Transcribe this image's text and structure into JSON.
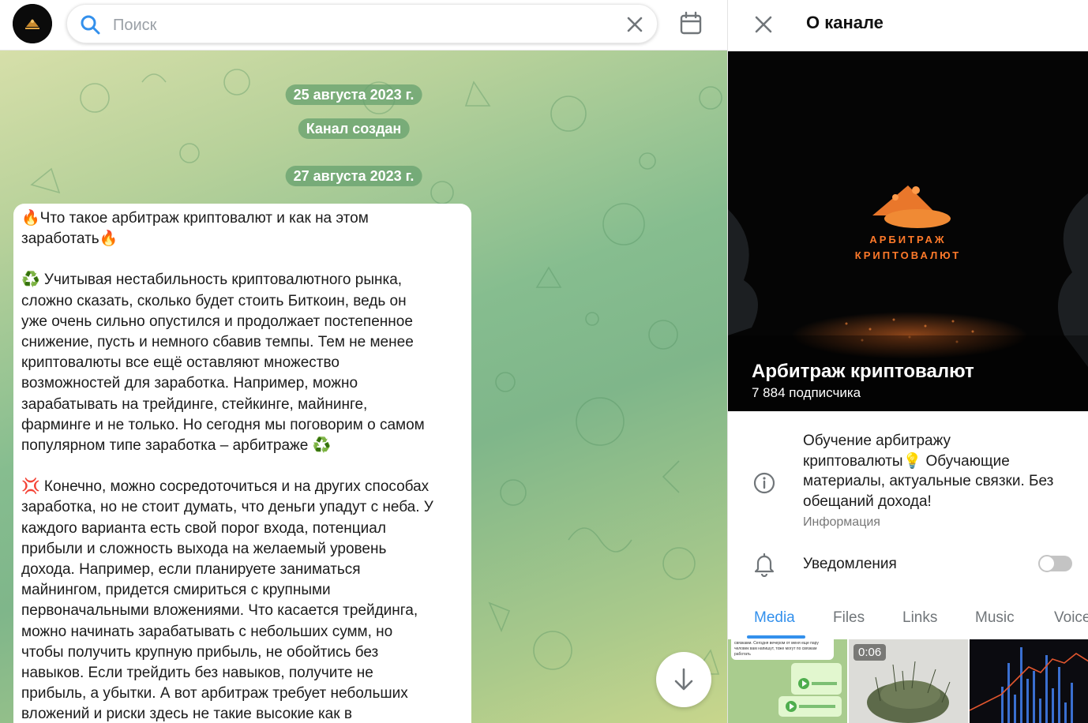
{
  "search": {
    "placeholder": "Поиск"
  },
  "chat": {
    "dates": [
      "25 августа 2023 г.",
      "27 августа 2023 г."
    ],
    "service_message": "Канал создан",
    "message": {
      "lines1": [
        "🔥Что такое арбитраж криптовалют и как на этом",
        "заработать🔥"
      ],
      "lines2": [
        "♻️ Учитывая нестабильность криптовалютного рынка,",
        "сложно сказать, сколько будет стоить Биткоин, ведь он",
        "уже очень сильно опустился и продолжает постепенное",
        "снижение, пусть и немного сбавив темпы. Тем не менее",
        "криптовалюты все ещё оставляют множество",
        "возможностей для заработка. Например, можно",
        "зарабатывать на трейдинге, стейкинге, майнинге,",
        "фарминге и не только. Но сегодня мы поговорим о самом",
        "популярном типе заработка – арбитраже ♻️"
      ],
      "lines3": [
        "💢 Конечно, можно сосредоточиться и на других способах",
        "заработка, но не стоит думать, что деньги упадут с неба. У",
        "каждого варианта есть свой порог входа, потенциал",
        "прибыли и сложность выхода на желаемый уровень",
        "дохода. Например, если планируете заниматься",
        "майнингом, придется смириться с крупными",
        "первоначальными вложениями. Что касается трейдинга,",
        "можно начинать зарабатывать с небольших сумм, но",
        "чтобы получить крупную прибыль, не обойтись без",
        "навыков. Если трейдить без навыков, получите не",
        "прибыль, а убытки. А вот арбитраж требует небольших",
        "вложений и риски здесь не такие высокие как в"
      ]
    }
  },
  "panel": {
    "title": "О канале",
    "channel_name": "Арбитраж криптовалют",
    "subscribers": "7 884 подписчика",
    "cover_text_line1": "АРБИТРАЖ",
    "cover_text_line2": "КРИПТОВАЛЮТ",
    "description_lines": [
      "Обучение арбитражу",
      "криптовалюты💡 Обучающие",
      "материалы, актуальные связки. Без",
      "обещаний дохода!"
    ],
    "description_label": "Информация",
    "notifications_label": "Уведомления",
    "notifications_on": false,
    "tabs": [
      "Media",
      "Files",
      "Links",
      "Music",
      "Voice"
    ],
    "active_tab": "Media",
    "media": [
      {
        "type": "screenshot",
        "lines": [
          "связками. Сегодня вечером от меня еще пару",
          "человек вам напишут, тоже могут по связкам",
          "работать"
        ]
      },
      {
        "type": "video",
        "duration": "0:06"
      },
      {
        "type": "chart"
      }
    ]
  },
  "colors": {
    "accent": "#3390ec",
    "pill": "#65a06e"
  }
}
